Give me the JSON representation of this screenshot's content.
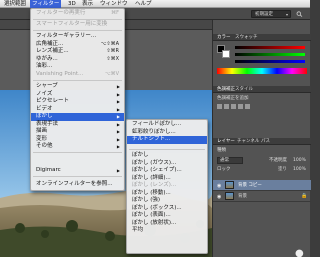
{
  "menubar": {
    "items": [
      {
        "label": "選択範囲",
        "active": false
      },
      {
        "label": "フィルター",
        "active": true
      },
      {
        "label": "3D",
        "active": false
      },
      {
        "label": "表示",
        "active": false
      },
      {
        "label": "ウィンドウ",
        "active": false
      },
      {
        "label": "ヘルプ",
        "active": false
      }
    ]
  },
  "options_bar": {
    "workspace_select": "初期設定"
  },
  "filter_menu": {
    "last_filter": {
      "label": "フィルターの再実行",
      "shortcut": "⌘F"
    },
    "smart_filter": {
      "label": "スマートフィルター用に変換"
    },
    "gallery": {
      "label": "フィルターギャラリー..."
    },
    "wide_angle": {
      "label": "広角補正...",
      "shortcut": "⌥⇧⌘A"
    },
    "lens_correction": {
      "label": "レンズ補正...",
      "shortcut": "⇧⌘R"
    },
    "liquify": {
      "label": "ゆがみ...",
      "shortcut": "⇧⌘X"
    },
    "oil_paint": {
      "label": "油彩..."
    },
    "vanishing_point": {
      "label": "Vanishing Point...",
      "shortcut": "⌥⌘V"
    },
    "sharpen": {
      "label": "シャープ"
    },
    "noise": {
      "label": "ノイズ"
    },
    "pixelate": {
      "label": "ピクセレート"
    },
    "video": {
      "label": "ビデオ"
    },
    "blur": {
      "label": "ぼかし"
    },
    "render": {
      "label": "表現手法"
    },
    "draw": {
      "label": "描画"
    },
    "distort": {
      "label": "変形"
    },
    "other": {
      "label": "その他"
    },
    "digimarc": {
      "label": "Digimarc"
    },
    "browse_online": {
      "label": "オンラインフィルターを参照..."
    }
  },
  "blur_submenu": {
    "field_blur": {
      "label": "フィールドぼかし..."
    },
    "iris_blur": {
      "label": "虹彩絞りぼかし..."
    },
    "tilt_shift": {
      "label": "チルトシフト..."
    },
    "blur_plain": {
      "label": "ぼかし"
    },
    "blur_gaussian": {
      "label": "ぼかし (ガウス)..."
    },
    "blur_shape": {
      "label": "ぼかし (シェイプ)..."
    },
    "blur_more": {
      "label": "ぼかし (詳細)..."
    },
    "blur_lens": {
      "label": "ぼかし (レンズ)..."
    },
    "blur_motion": {
      "label": "ぼかし (移動)..."
    },
    "blur_strong": {
      "label": "ぼかし (強)"
    },
    "blur_box": {
      "label": "ぼかし (ボックス)..."
    },
    "blur_surface": {
      "label": "ぼかし (表面)..."
    },
    "blur_radial": {
      "label": "ぼかし (放射状)..."
    },
    "average": {
      "label": "平均"
    }
  },
  "panels": {
    "color_tab": "カラー",
    "swatch_tab": "スウォッチ",
    "adjust_tab": "色調補正",
    "style_tab": "スタイル",
    "adjust_add": "色調補正を追加",
    "layers_tab": "レイヤー",
    "channels_tab": "チャンネル",
    "paths_tab": "パス",
    "kind_label": "種類",
    "blend_mode": "通常",
    "opacity_label": "不透明度",
    "opacity_value": "100%",
    "lock_label": "ロック",
    "fill_label": "塗り",
    "fill_value": "100%",
    "layers": [
      {
        "name": "背景 コピー",
        "selected": true
      },
      {
        "name": "背景",
        "selected": false
      }
    ]
  },
  "colors": {
    "menu_highlight": "#2f64d8",
    "panel_bg": "#535353"
  }
}
